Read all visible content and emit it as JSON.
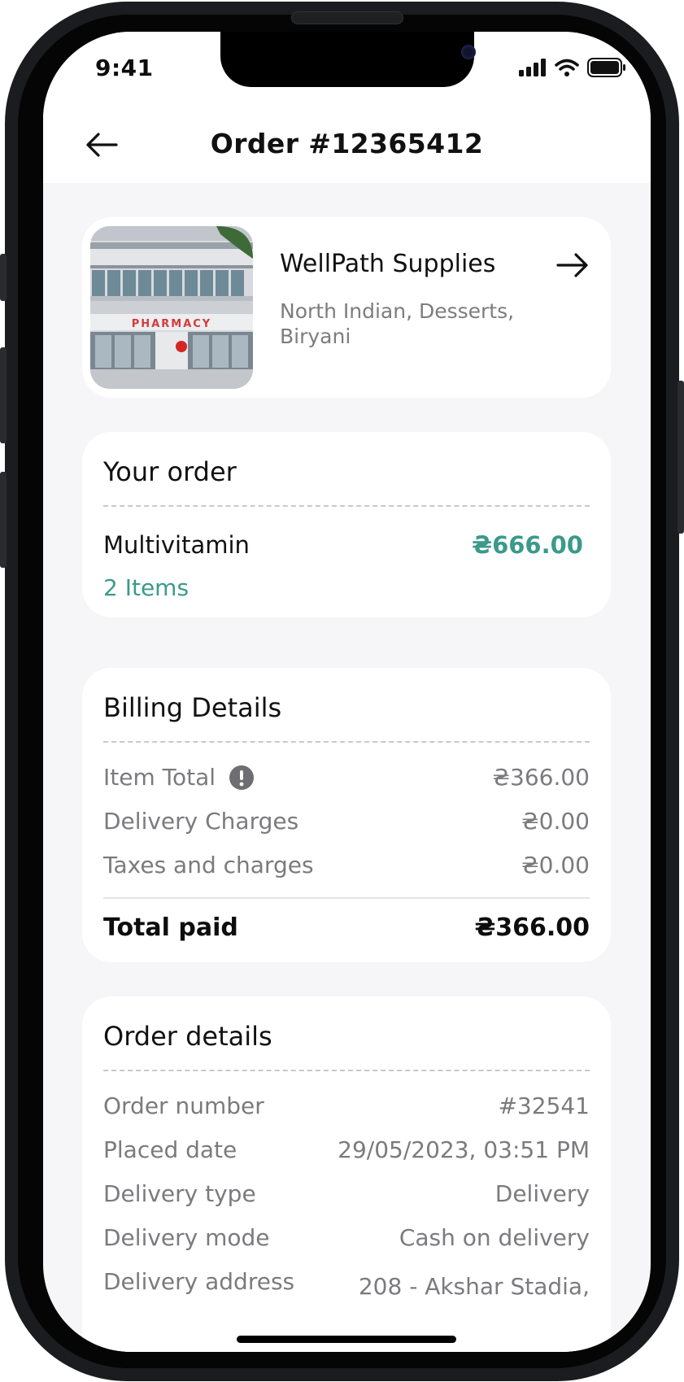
{
  "status_bar": {
    "time": "9:41"
  },
  "header": {
    "title": "Order #12365412",
    "back_icon": "arrow-left-icon"
  },
  "store": {
    "name": "WellPath Supplies",
    "tags": "North Indian, Desserts, Biryani",
    "sign_text": "PHARMACY",
    "open_icon": "arrow-right-icon"
  },
  "your_order": {
    "title": "Your order",
    "item_name": "Multivitamin",
    "item_price": "₴666.00",
    "item_count": "2 Items"
  },
  "billing": {
    "title": "Billing Details",
    "rows": [
      {
        "label": "Item Total",
        "value": "₴366.00"
      },
      {
        "label": "Delivery Charges",
        "value": "₴0.00"
      },
      {
        "label": "Taxes and charges",
        "value": "₴0.00"
      }
    ],
    "total_label": "Total paid",
    "total_value": "₴366.00"
  },
  "order_details": {
    "title": "Order details",
    "rows": [
      {
        "label": "Order number",
        "value": "#32541"
      },
      {
        "label": "Placed date",
        "value": "29/05/2023, 03:51 PM"
      },
      {
        "label": "Delivery type",
        "value": "Delivery"
      },
      {
        "label": "Delivery mode",
        "value": "Cash on delivery"
      },
      {
        "label": "Delivery address",
        "value": "208 - Akshar Stadia,"
      }
    ]
  },
  "colors": {
    "accent": "#3b9a8a",
    "background": "#f6f6f8",
    "card": "#ffffff"
  }
}
